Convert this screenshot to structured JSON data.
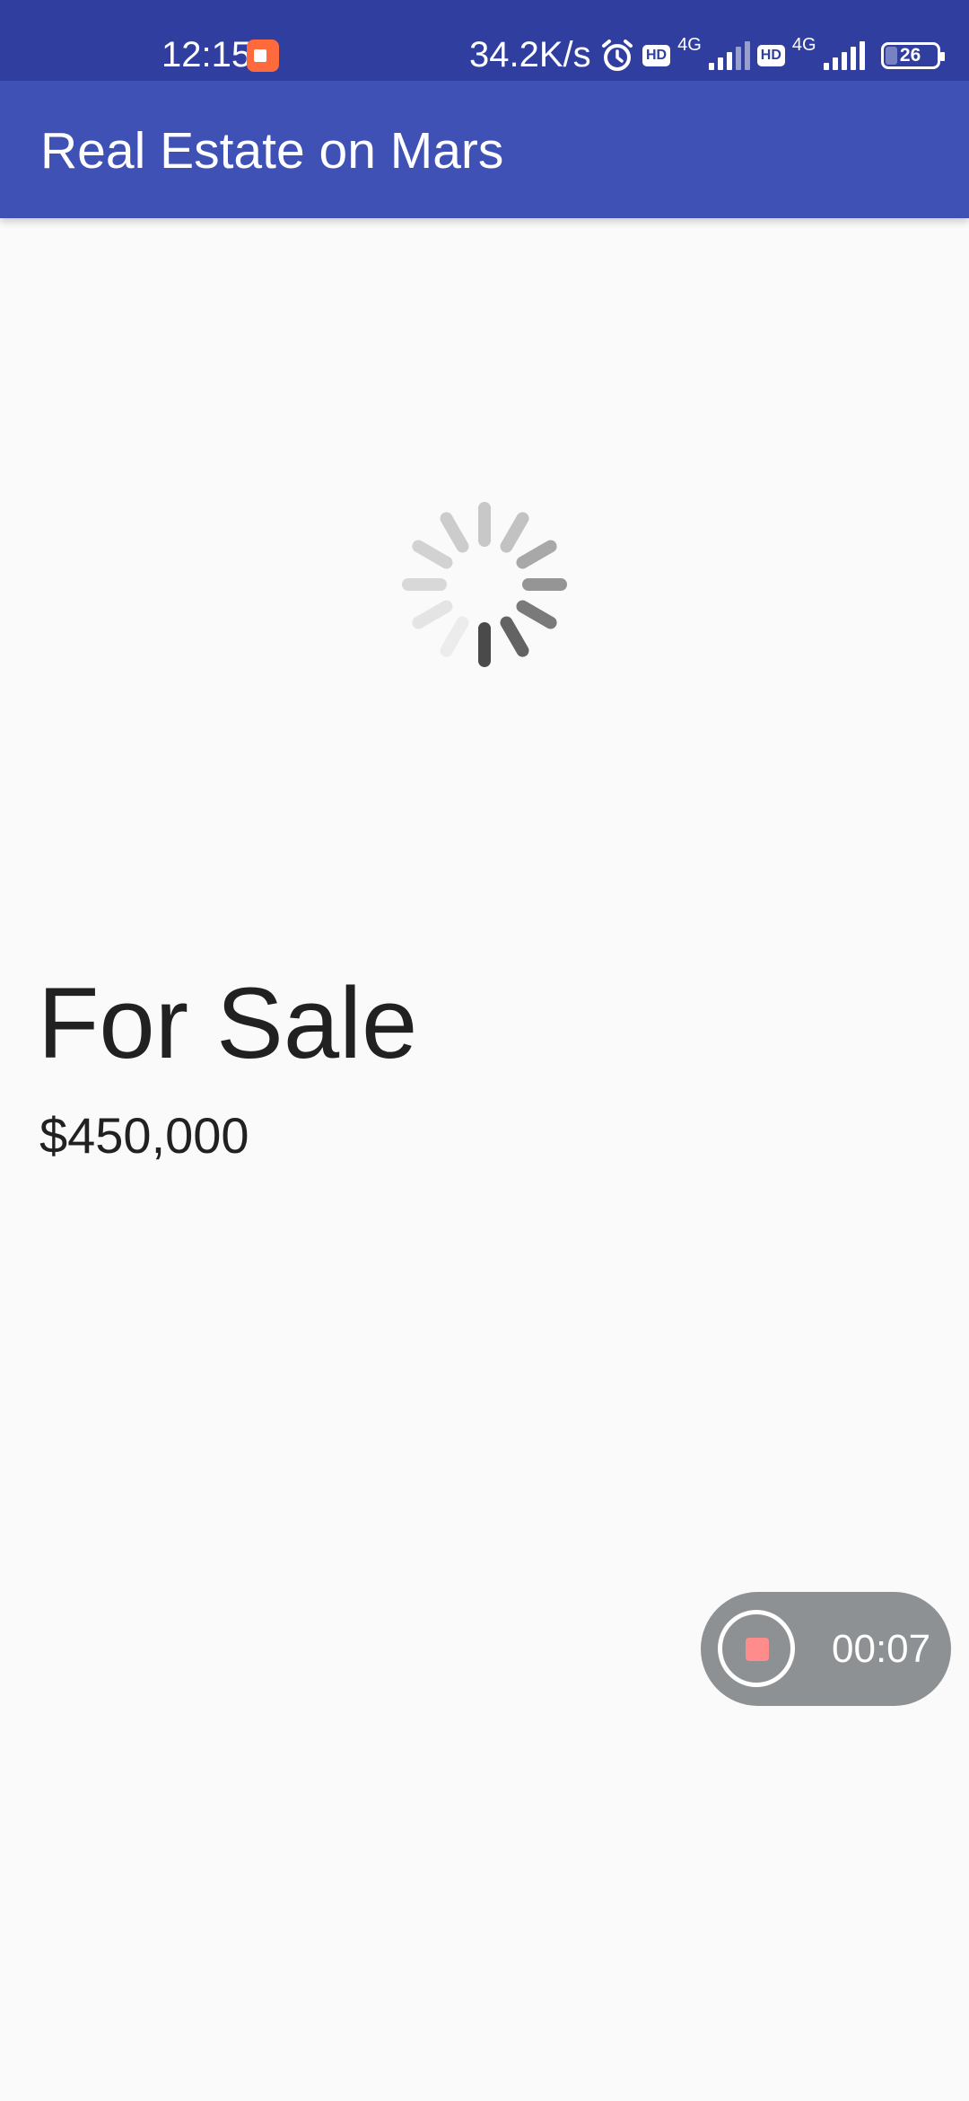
{
  "status_bar": {
    "time": "12:15",
    "speed": "34.2K/s",
    "hd_label_1": "HD",
    "network_1": "4G",
    "hd_label_2": "HD",
    "network_2": "4G",
    "battery": "26",
    "icons": [
      "screen-record-icon",
      "alarm-icon",
      "signal-icon",
      "signal-icon",
      "battery-icon"
    ]
  },
  "app_bar": {
    "title": "Real Estate on Mars"
  },
  "listing": {
    "heading": "For Sale",
    "price": "$450,000"
  },
  "recorder": {
    "timer": "00:07"
  },
  "colors": {
    "status_bar": "#303f9f",
    "app_bar": "#3f51b5",
    "background": "#fafafa",
    "recorder": "#8e9193",
    "stop": "#ff8c8c"
  }
}
